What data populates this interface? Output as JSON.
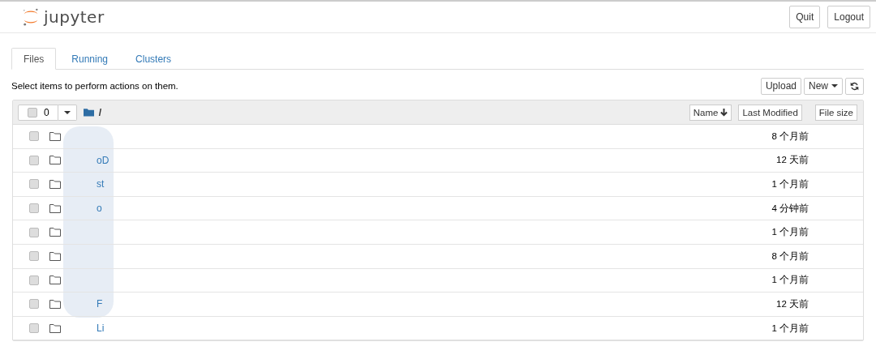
{
  "header": {
    "logo_text": "jupyter",
    "buttons": [
      "Quit",
      "Logout"
    ]
  },
  "tabs": [
    {
      "label": "Files",
      "selected": true
    },
    {
      "label": "Running",
      "selected": false
    },
    {
      "label": "Clusters",
      "selected": false
    }
  ],
  "toolbar": {
    "hint": "Select items to perform actions on them.",
    "buttons": [
      {
        "label": "Upload",
        "kind": "text"
      },
      {
        "label": "New",
        "kind": "dropdown"
      },
      {
        "kind": "refresh"
      }
    ]
  },
  "list_header": {
    "select_all_checked": false,
    "selected_count": "0",
    "path": "/",
    "sort_buttons": [
      {
        "label": "Name",
        "sorted": true
      },
      {
        "label": "Last Modified",
        "sorted": false
      },
      {
        "label": "File size",
        "sorted": false
      }
    ]
  },
  "rows": [
    {
      "checked": false,
      "modified": "8 个月前"
    },
    {
      "checked": false,
      "name": "oD",
      "modified": "12 天前"
    },
    {
      "checked": false,
      "name": "st",
      "modified": "1 个月前"
    },
    {
      "checked": false,
      "name": "o",
      "modified": "4 分钟前"
    },
    {
      "checked": false,
      "modified": "1 个月前"
    },
    {
      "checked": false,
      "modified": "8 个月前"
    },
    {
      "checked": false,
      "modified": "1 个月前"
    },
    {
      "checked": false,
      "name": "F",
      "modified": "12 天前"
    },
    {
      "checked": false,
      "name": "Li",
      "modified": "1 个月前"
    }
  ]
}
